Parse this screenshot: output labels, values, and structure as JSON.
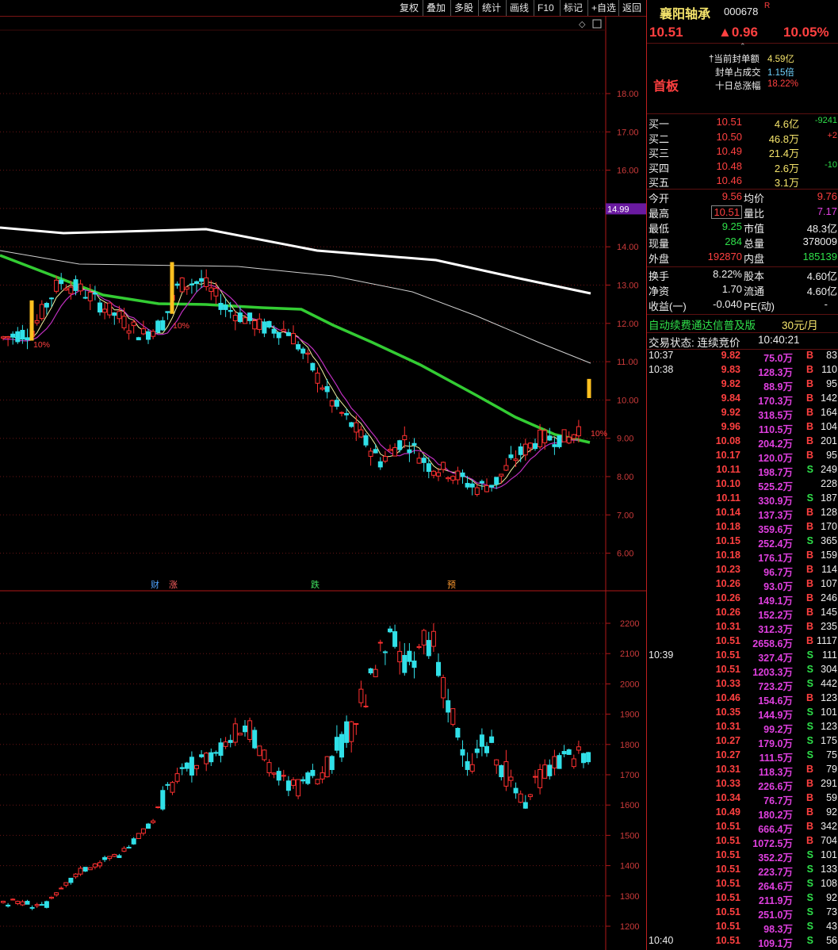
{
  "toolbar": {
    "buttons": [
      "复权",
      "叠加",
      "多股",
      "统计",
      "画线",
      "F10",
      "标记",
      "+自选",
      "返回"
    ]
  },
  "chart": {
    "price_axis": [
      "18.00",
      "17.00",
      "16.00",
      "15.00",
      "14.00",
      "13.00",
      "12.00",
      "11.00",
      "10.00",
      "9.00",
      "8.00",
      "7.00",
      "6.00"
    ],
    "price_tag": "14.99",
    "limit_labels": [
      "10%",
      "10%",
      "10%"
    ],
    "markers": [
      {
        "text": "财",
        "color": "#4fa3ff"
      },
      {
        "text": "涨",
        "color": "#ff6060"
      },
      {
        "text": "跌",
        "color": "#3fe060"
      },
      {
        "text": "预",
        "color": "#ff9a30"
      }
    ],
    "index_axis": [
      "2200",
      "2100",
      "2000",
      "1900",
      "1800",
      "1700",
      "1600",
      "1500",
      "1400",
      "1300",
      "1200"
    ]
  },
  "stock": {
    "name": "襄阳轴承",
    "code": "000678",
    "flag": "R",
    "price": "10.51",
    "change": "▲0.96",
    "change_pct": "10.05%",
    "board_label": "首板",
    "seal_lines": [
      {
        "label": "†当前封单额",
        "value": "4.59亿"
      },
      {
        "label": "封单占成交",
        "value": "1.15倍"
      },
      {
        "label": "十日总涨幅",
        "value": "18.22%"
      }
    ]
  },
  "order_book": [
    {
      "label": "买一",
      "price": "10.51",
      "vol": "4.6亿",
      "delta": "-9241"
    },
    {
      "label": "买二",
      "price": "10.50",
      "vol": "46.8万",
      "delta": "+2"
    },
    {
      "label": "买三",
      "price": "10.49",
      "vol": "21.4万",
      "delta": ""
    },
    {
      "label": "买四",
      "price": "10.48",
      "vol": "2.6万",
      "delta": "-10"
    },
    {
      "label": "买五",
      "price": "10.46",
      "vol": "3.1万",
      "delta": ""
    }
  ],
  "stats": {
    "open_l": "今开",
    "open": "9.56",
    "avg_l": "均价",
    "avg": "9.76",
    "high_l": "最高",
    "high": "10.51",
    "vr_l": "量比",
    "vr": "7.17",
    "low_l": "最低",
    "low": "9.25",
    "mcap_l": "市值",
    "mcap": "48.3亿",
    "cur_l": "现量",
    "cur": "284",
    "total_l": "总量",
    "total": "378009",
    "out_l": "外盘",
    "out": "192870",
    "in_l": "内盘",
    "in": "185139",
    "turn_l": "换手",
    "turn": "8.22%",
    "cap_l": "股本",
    "cap": "4.60亿",
    "na_l": "净资",
    "na": "1.70",
    "float_l": "流通",
    "float": "4.60亿",
    "eps_l": "收益(一)",
    "eps": "-0.040",
    "pe_l": "PE(动)",
    "pe": "-"
  },
  "promo": {
    "text": "自动续费通达信普及版",
    "price": "30元/月"
  },
  "trade_status": {
    "label": "交易状态: 连续竞价",
    "time": "10:40:21"
  },
  "ticks": [
    {
      "t": "10:37",
      "p": "9.82",
      "v": "75.0万",
      "s": "B",
      "n": "83"
    },
    {
      "t": "10:38",
      "p": "9.83",
      "v": "128.3万",
      "s": "B",
      "n": "110"
    },
    {
      "t": "",
      "p": "9.82",
      "v": "88.9万",
      "s": "B",
      "n": "95"
    },
    {
      "t": "",
      "p": "9.84",
      "v": "170.3万",
      "s": "B",
      "n": "142"
    },
    {
      "t": "",
      "p": "9.92",
      "v": "318.5万",
      "s": "B",
      "n": "164"
    },
    {
      "t": "",
      "p": "9.96",
      "v": "110.5万",
      "s": "B",
      "n": "104"
    },
    {
      "t": "",
      "p": "10.08",
      "v": "204.2万",
      "s": "B",
      "n": "201"
    },
    {
      "t": "",
      "p": "10.17",
      "v": "120.0万",
      "s": "B",
      "n": "95"
    },
    {
      "t": "",
      "p": "10.11",
      "v": "198.7万",
      "s": "S",
      "n": "249"
    },
    {
      "t": "",
      "p": "10.10",
      "v": "525.2万",
      "s": "",
      "n": "228"
    },
    {
      "t": "",
      "p": "10.11",
      "v": "330.9万",
      "s": "S",
      "n": "187"
    },
    {
      "t": "",
      "p": "10.14",
      "v": "137.3万",
      "s": "B",
      "n": "128"
    },
    {
      "t": "",
      "p": "10.18",
      "v": "359.6万",
      "s": "B",
      "n": "170"
    },
    {
      "t": "",
      "p": "10.15",
      "v": "252.4万",
      "s": "S",
      "n": "365"
    },
    {
      "t": "",
      "p": "10.18",
      "v": "176.1万",
      "s": "B",
      "n": "159"
    },
    {
      "t": "",
      "p": "10.23",
      "v": "96.7万",
      "s": "B",
      "n": "114"
    },
    {
      "t": "",
      "p": "10.26",
      "v": "93.0万",
      "s": "B",
      "n": "107"
    },
    {
      "t": "",
      "p": "10.26",
      "v": "149.1万",
      "s": "B",
      "n": "246"
    },
    {
      "t": "",
      "p": "10.26",
      "v": "152.2万",
      "s": "B",
      "n": "145"
    },
    {
      "t": "",
      "p": "10.31",
      "v": "312.3万",
      "s": "B",
      "n": "235"
    },
    {
      "t": "",
      "p": "10.51",
      "v": "2658.6万",
      "s": "B",
      "n": "1117"
    },
    {
      "t": "10:39",
      "p": "10.51",
      "v": "327.4万",
      "s": "S",
      "n": "111"
    },
    {
      "t": "",
      "p": "10.51",
      "v": "1203.3万",
      "s": "S",
      "n": "304"
    },
    {
      "t": "",
      "p": "10.33",
      "v": "723.2万",
      "s": "S",
      "n": "442"
    },
    {
      "t": "",
      "p": "10.46",
      "v": "154.6万",
      "s": "B",
      "n": "123"
    },
    {
      "t": "",
      "p": "10.35",
      "v": "144.9万",
      "s": "S",
      "n": "101"
    },
    {
      "t": "",
      "p": "10.31",
      "v": "99.2万",
      "s": "S",
      "n": "123"
    },
    {
      "t": "",
      "p": "10.27",
      "v": "179.0万",
      "s": "S",
      "n": "175"
    },
    {
      "t": "",
      "p": "10.27",
      "v": "111.5万",
      "s": "S",
      "n": "75"
    },
    {
      "t": "",
      "p": "10.31",
      "v": "118.3万",
      "s": "B",
      "n": "79"
    },
    {
      "t": "",
      "p": "10.33",
      "v": "226.6万",
      "s": "B",
      "n": "291"
    },
    {
      "t": "",
      "p": "10.34",
      "v": "76.7万",
      "s": "B",
      "n": "59"
    },
    {
      "t": "",
      "p": "10.49",
      "v": "180.2万",
      "s": "B",
      "n": "92"
    },
    {
      "t": "",
      "p": "10.51",
      "v": "666.4万",
      "s": "B",
      "n": "342"
    },
    {
      "t": "",
      "p": "10.51",
      "v": "1072.5万",
      "s": "B",
      "n": "704"
    },
    {
      "t": "",
      "p": "10.51",
      "v": "352.2万",
      "s": "S",
      "n": "101"
    },
    {
      "t": "",
      "p": "10.51",
      "v": "223.7万",
      "s": "S",
      "n": "133"
    },
    {
      "t": "",
      "p": "10.51",
      "v": "264.6万",
      "s": "S",
      "n": "108"
    },
    {
      "t": "",
      "p": "10.51",
      "v": "211.9万",
      "s": "S",
      "n": "92"
    },
    {
      "t": "",
      "p": "10.51",
      "v": "251.0万",
      "s": "S",
      "n": "73"
    },
    {
      "t": "",
      "p": "10.51",
      "v": "98.3万",
      "s": "S",
      "n": "43"
    },
    {
      "t": "10:40",
      "p": "10.51",
      "v": "109.1万",
      "s": "S",
      "n": "56"
    }
  ],
  "colors": {
    "up": "#ff3030",
    "down": "#30e0e8",
    "limit": "#ffc020",
    "ma_white": "#ffffff",
    "ma_green": "#33cc33",
    "ma_mag": "#c030c0",
    "ma_yellow": "#f0f0a0"
  }
}
